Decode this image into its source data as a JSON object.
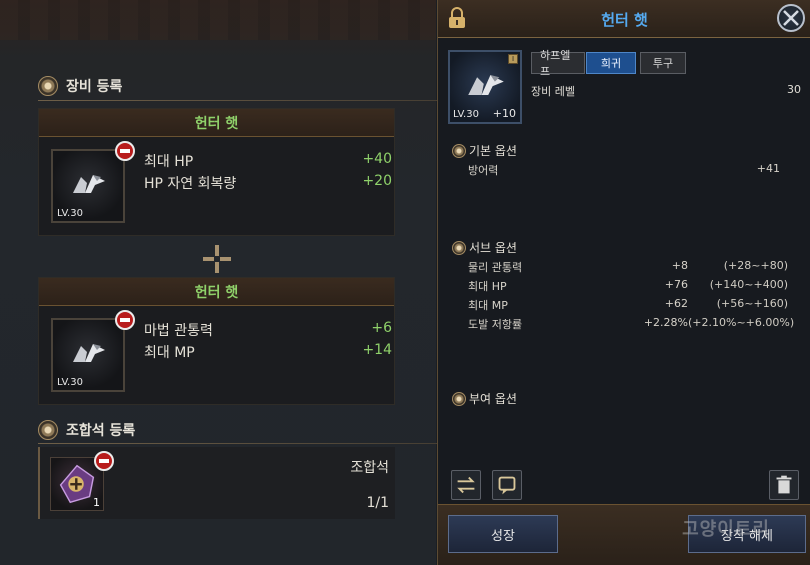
{
  "left": {
    "equip_section_title": "장비 등록",
    "slot1": {
      "item_name": "헌터 햇",
      "level_label": "LV.30",
      "stats": [
        {
          "name": "최대 HP",
          "value": "+40"
        },
        {
          "name": "HP 자연 회복량",
          "value": "+20"
        }
      ]
    },
    "slot2": {
      "item_name": "헌터 햇",
      "level_label": "LV.30",
      "stats": [
        {
          "name": "마법 관통력",
          "value": "+6"
        },
        {
          "name": "최대 MP",
          "value": "+14"
        }
      ]
    },
    "gem_section_title": "조합석 등록",
    "gem": {
      "name": "조합석",
      "count": "1",
      "quantity": "1/1"
    }
  },
  "right": {
    "title": "헌터 햇",
    "item": {
      "level_label": "LV.30",
      "enhance": "+10",
      "badge": "I"
    },
    "tags": [
      "하프엘프",
      "희귀",
      "투구"
    ],
    "selected_tag": "희귀",
    "equip_level_label": "장비 레벨",
    "equip_level_value": "30",
    "base_options_title": "기본 옵션",
    "base_options": [
      {
        "name": "방어력",
        "value": "+41",
        "range": ""
      }
    ],
    "sub_options_title": "서브 옵션",
    "sub_options": [
      {
        "name": "물리 관통력",
        "value": "+8",
        "range": "(+28~+80)"
      },
      {
        "name": "최대 HP",
        "value": "+76",
        "range": "(+140~+400)"
      },
      {
        "name": "최대 MP",
        "value": "+62",
        "range": "(+56~+160)"
      },
      {
        "name": "도발 저항률",
        "value": "+2.28%",
        "range": "(+2.10%~+6.00%)"
      }
    ],
    "grant_options_title": "부여 옵션",
    "grow_button": "성장",
    "unequip_button": "장착 해제"
  },
  "watermark": "고양이트리",
  "colors": {
    "stat_positive": "#8fd16a",
    "title_blue": "#55aaf0",
    "remove_red": "#b81c1c"
  },
  "icons": {
    "lock": "lock-icon",
    "close": "close-x-icon",
    "swap": "swap-arrows-icon",
    "chat": "message-icon",
    "trash": "trash-icon",
    "remove": "remove-minus-icon"
  }
}
